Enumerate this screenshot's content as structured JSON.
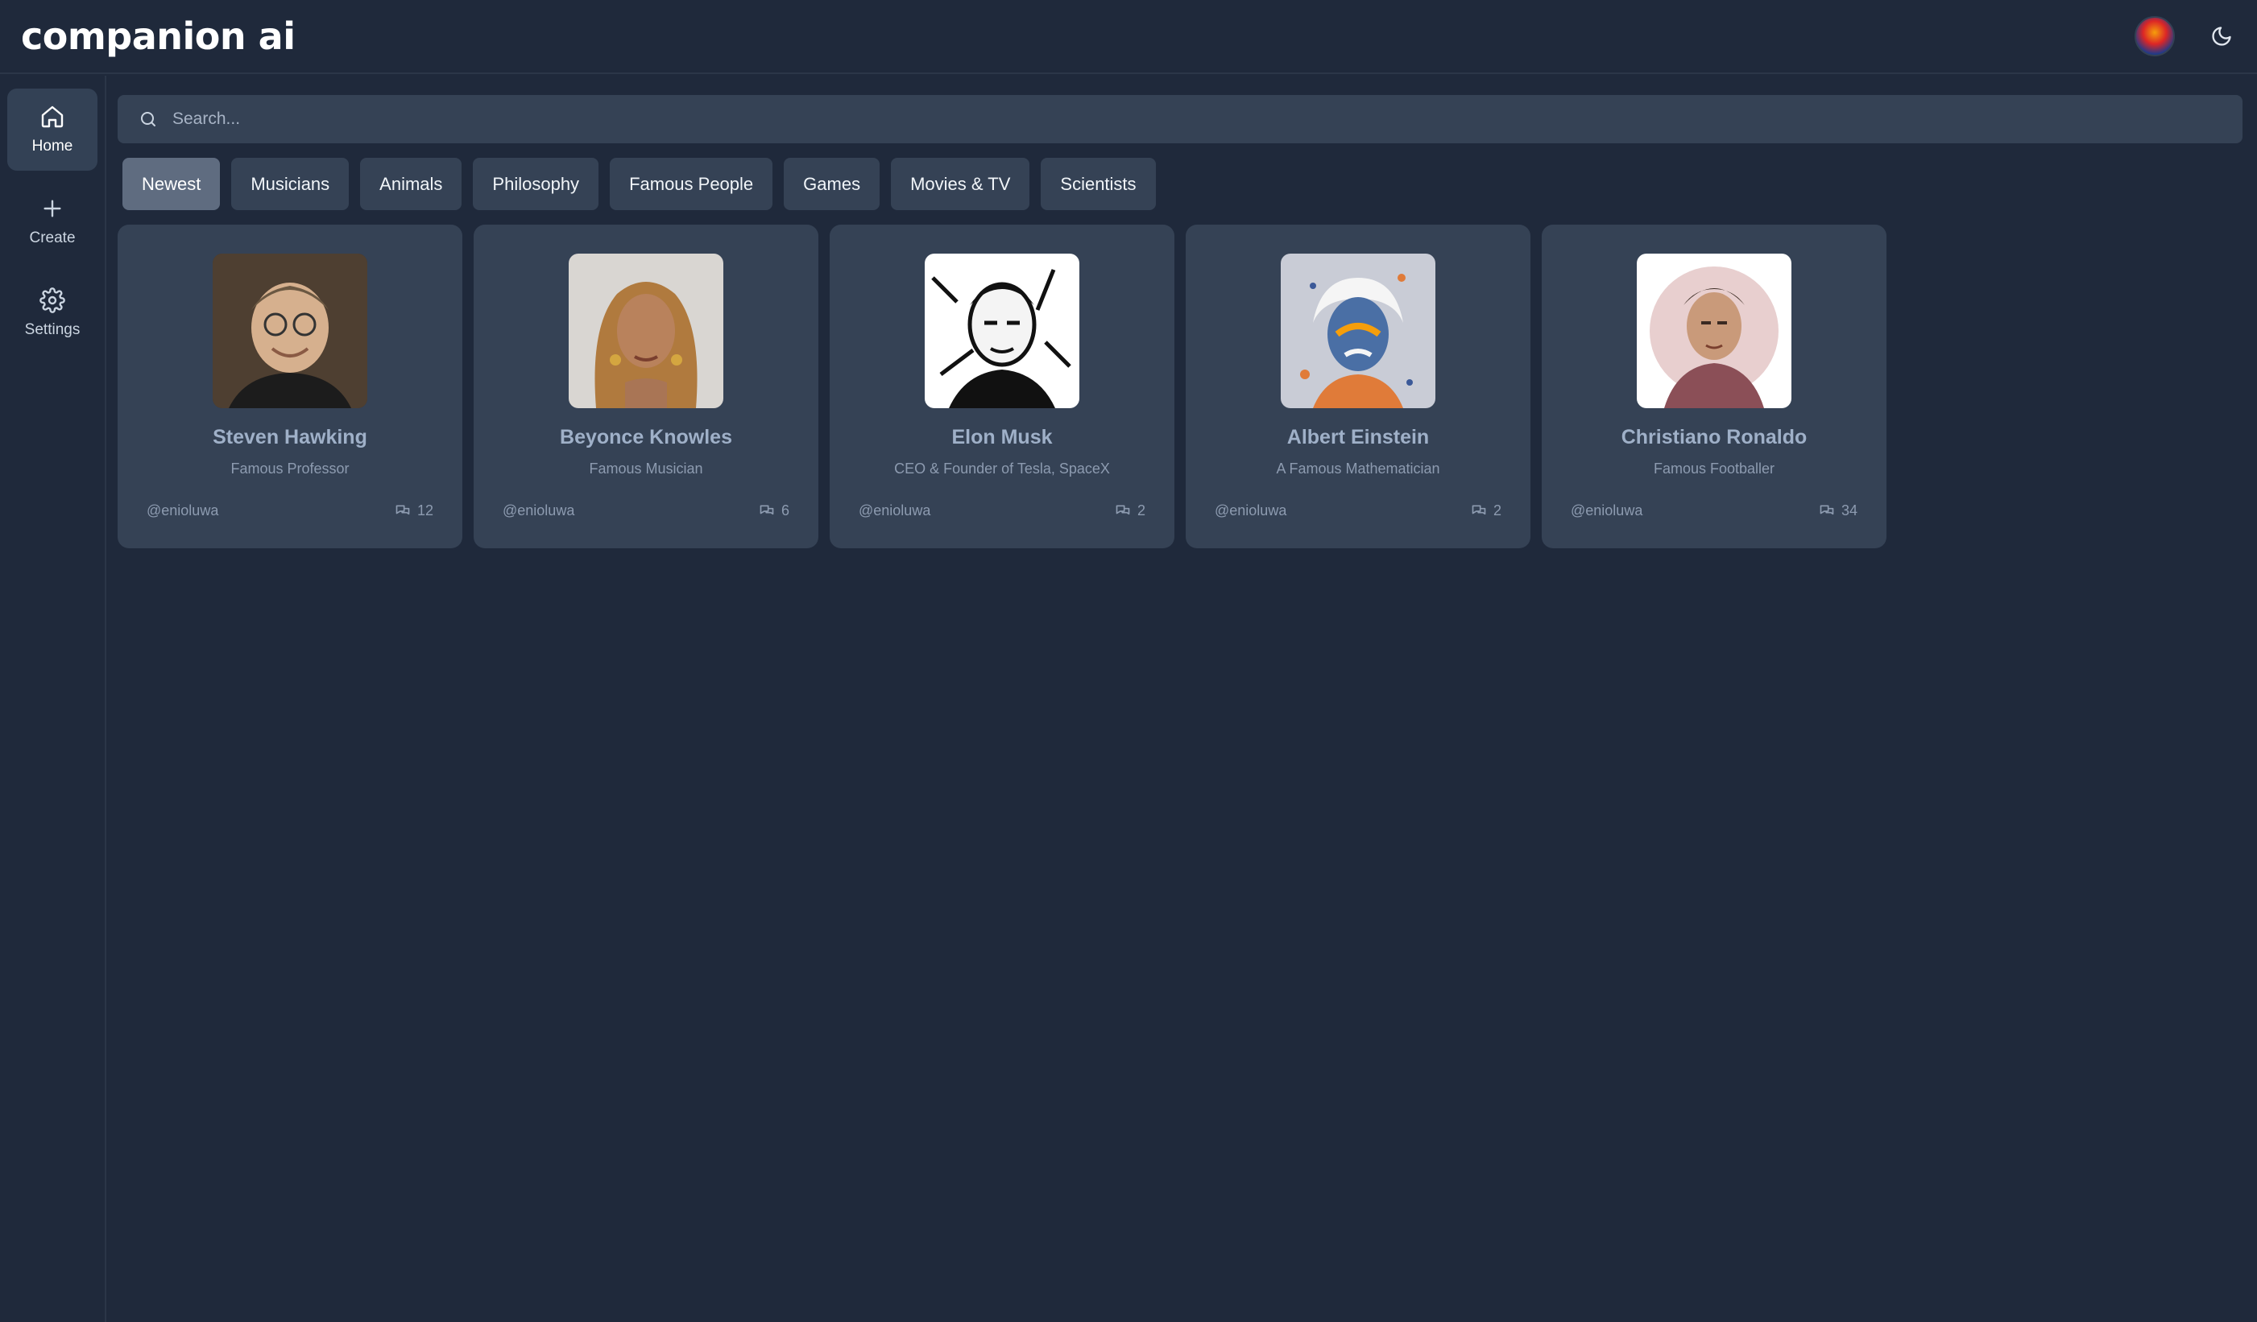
{
  "header": {
    "brand": "companion ai",
    "avatar_icon": "user-avatar",
    "theme_icon": "moon-icon"
  },
  "sidebar": {
    "items": [
      {
        "label": "Home",
        "icon": "home-icon",
        "active": true
      },
      {
        "label": "Create",
        "icon": "plus-icon",
        "active": false
      },
      {
        "label": "Settings",
        "icon": "gear-icon",
        "active": false
      }
    ]
  },
  "search": {
    "placeholder": "Search...",
    "value": ""
  },
  "categories": [
    {
      "label": "Newest",
      "active": true
    },
    {
      "label": "Musicians",
      "active": false
    },
    {
      "label": "Animals",
      "active": false
    },
    {
      "label": "Philosophy",
      "active": false
    },
    {
      "label": "Famous People",
      "active": false
    },
    {
      "label": "Games",
      "active": false
    },
    {
      "label": "Movies & TV",
      "active": false
    },
    {
      "label": "Scientists",
      "active": false
    }
  ],
  "companions": [
    {
      "name": "Steven Hawking",
      "description": "Famous Professor",
      "author": "@enioluwa",
      "messages": "12"
    },
    {
      "name": "Beyonce Knowles",
      "description": "Famous Musician",
      "author": "@enioluwa",
      "messages": "6"
    },
    {
      "name": "Elon Musk",
      "description": "CEO & Founder of Tesla, SpaceX",
      "author": "@enioluwa",
      "messages": "2"
    },
    {
      "name": "Albert Einstein",
      "description": "A Famous Mathematician",
      "author": "@enioluwa",
      "messages": "2"
    },
    {
      "name": "Christiano Ronaldo",
      "description": "Famous Footballer",
      "author": "@enioluwa",
      "messages": "34"
    }
  ],
  "colors": {
    "background": "#1f293b",
    "surface": "#354255",
    "active_chip": "#5f6c80",
    "name_text": "#9fb0c8"
  }
}
